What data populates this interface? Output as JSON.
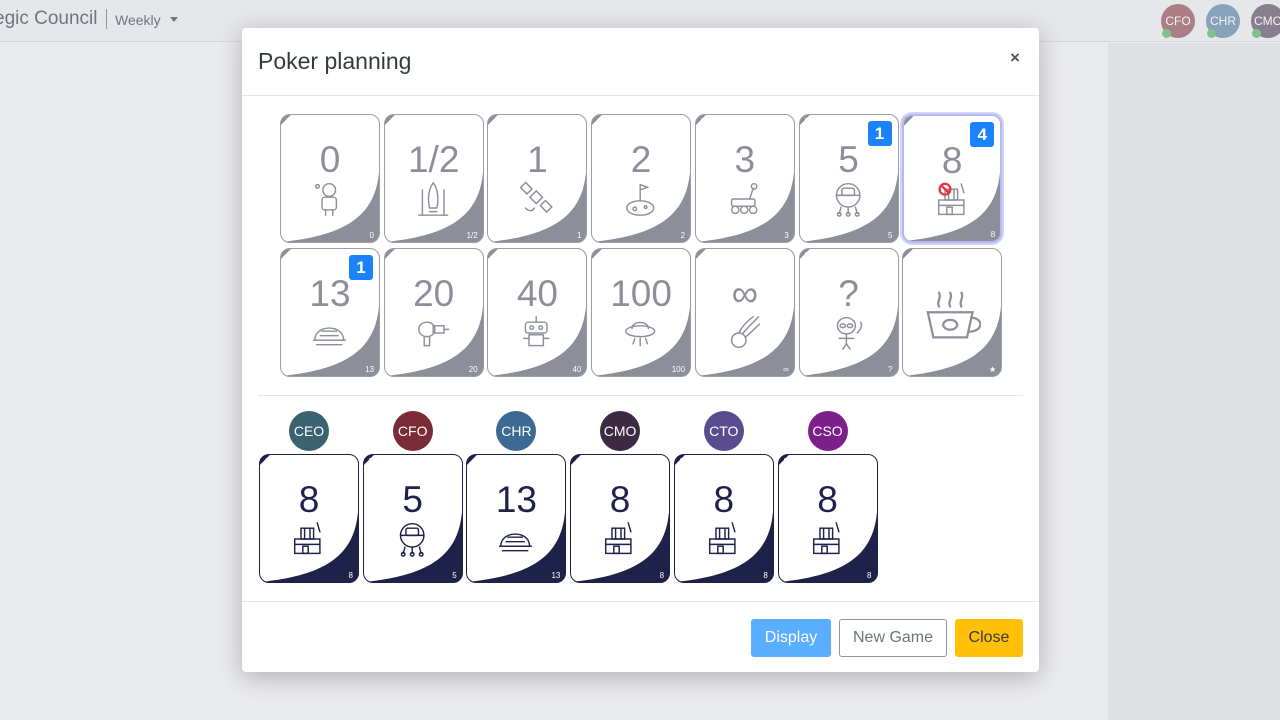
{
  "app": {
    "title": "egic Council",
    "period": "Weekly",
    "top_avatars": [
      {
        "label": "CFO",
        "color": "#7b2b35"
      },
      {
        "label": "CHR",
        "color": "#3c6a93"
      },
      {
        "label": "CMO",
        "color": "#3c2a44"
      }
    ]
  },
  "modal": {
    "title": "Poker planning",
    "close_symbol": "×",
    "deck": [
      {
        "value": "0",
        "corner": "0",
        "icon": "astronaut-icon",
        "badge": ""
      },
      {
        "value": "1/2",
        "corner": "1/2",
        "icon": "rocket-launch-icon",
        "badge": ""
      },
      {
        "value": "1",
        "corner": "1",
        "icon": "satellite-icon",
        "badge": ""
      },
      {
        "value": "2",
        "corner": "2",
        "icon": "moon-flag-icon",
        "badge": ""
      },
      {
        "value": "3",
        "corner": "3",
        "icon": "lunar-rover-icon",
        "badge": ""
      },
      {
        "value": "5",
        "corner": "5",
        "icon": "space-capsule-icon",
        "badge": "1"
      },
      {
        "value": "8",
        "corner": "8",
        "icon": "space-station-icon",
        "badge": "4",
        "selected": true
      },
      {
        "value": "13",
        "corner": "13",
        "icon": "moon-base-dome-icon",
        "badge": "1"
      },
      {
        "value": "20",
        "corner": "20",
        "icon": "ray-gun-icon",
        "badge": ""
      },
      {
        "value": "40",
        "corner": "40",
        "icon": "robot-icon",
        "badge": ""
      },
      {
        "value": "100",
        "corner": "100",
        "icon": "ufo-icon",
        "badge": ""
      },
      {
        "value": "∞",
        "corner": "∞",
        "icon": "comet-icon",
        "badge": ""
      },
      {
        "value": "?",
        "corner": "?",
        "icon": "alien-icon",
        "badge": ""
      },
      {
        "value": "",
        "corner": "★",
        "icon": "coffee-cup-icon",
        "badge": ""
      }
    ],
    "votes": [
      {
        "player": "CEO",
        "color": "#3b6271",
        "value": "8",
        "corner": "8",
        "icon": "space-station-icon"
      },
      {
        "player": "CFO",
        "color": "#7b2b35",
        "value": "5",
        "corner": "5",
        "icon": "space-capsule-icon"
      },
      {
        "player": "CHR",
        "color": "#3c6a93",
        "value": "13",
        "corner": "13",
        "icon": "moon-base-dome-icon"
      },
      {
        "player": "CMO",
        "color": "#3c2a44",
        "value": "8",
        "corner": "8",
        "icon": "space-station-icon"
      },
      {
        "player": "CTO",
        "color": "#5a4d8f",
        "value": "8",
        "corner": "8",
        "icon": "space-station-icon"
      },
      {
        "player": "CSO",
        "color": "#7d1f8a",
        "value": "8",
        "corner": "8",
        "icon": "space-station-icon"
      }
    ],
    "buttons": {
      "display": "Display",
      "new_game": "New Game",
      "close": "Close"
    }
  }
}
